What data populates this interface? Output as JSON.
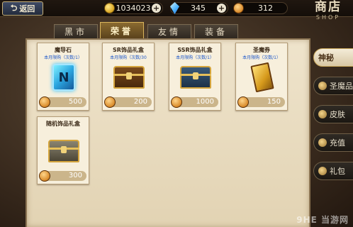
{
  "topbar": {
    "back_label": "返回",
    "gold": "1034023",
    "crystal": "345",
    "medals": "312",
    "shop_title": "商店",
    "shop_subtitle": "SHOP"
  },
  "tabs": [
    {
      "label": "黑市",
      "active": false
    },
    {
      "label": "荣誉",
      "active": true
    },
    {
      "label": "友情",
      "active": false
    },
    {
      "label": "装备",
      "active": false
    }
  ],
  "items": [
    {
      "name": "魔导石",
      "limit": "本月限购（次数/1）",
      "price": "500",
      "icon": "rune-stone-icon"
    },
    {
      "name": "SR饰品礼盒",
      "limit": "本月限购（次数/30",
      "price": "200",
      "icon": "sr-chest-icon"
    },
    {
      "name": "SSR饰品礼盒",
      "limit": "本月限购（次数/1）",
      "price": "1000",
      "icon": "ssr-chest-icon"
    },
    {
      "name": "圣魔券",
      "limit": "本月限购（次数/1）",
      "price": "150",
      "icon": "ticket-icon"
    },
    {
      "name": "随机饰品礼盒",
      "limit": "",
      "price": "300",
      "icon": "random-chest-icon"
    }
  ],
  "side_menu": [
    {
      "label": "神秘",
      "active": true
    },
    {
      "label": "圣魔品",
      "active": false
    },
    {
      "label": "皮肤",
      "active": false
    },
    {
      "label": "充值",
      "active": false
    },
    {
      "label": "礼包",
      "active": false
    }
  ],
  "watermark": "9HE 当游网"
}
